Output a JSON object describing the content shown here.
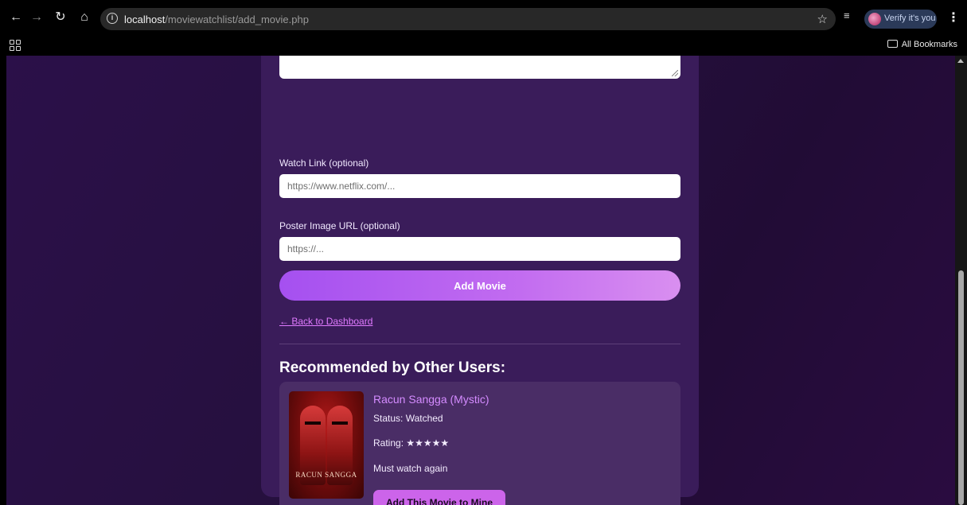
{
  "browser": {
    "url_host": "localhost",
    "url_path": "/moviewatchlist/add_movie.php",
    "profile_label": "Verify it's you",
    "all_bookmarks_label": "All Bookmarks",
    "icons": {
      "back": "back-arrow-icon",
      "forward": "forward-arrow-icon",
      "reload": "reload-icon",
      "home": "home-icon",
      "site_info": "info-icon",
      "bookmark_star": "star-icon",
      "tab_search": "tab-search-icon",
      "menu": "kebab-menu-icon",
      "apps": "apps-grid-icon",
      "folder": "folder-icon"
    }
  },
  "form": {
    "watch_link_label": "Watch Link (optional)",
    "watch_link_placeholder": "https://www.netflix.com/...",
    "watch_link_value": "",
    "poster_label": "Poster Image URL (optional)",
    "poster_placeholder": "https://...",
    "poster_value": "",
    "submit_label": "Add Movie",
    "back_link": "← Back to Dashboard"
  },
  "recommendations": {
    "heading": "Recommended by Other Users:",
    "items": [
      {
        "title": "Racun Sangga (Mystic)",
        "status": "Status: Watched",
        "rating": "Rating: ★★★★★",
        "note": "Must watch again",
        "action_label": "Add This Movie to Mine",
        "poster_text": "RACUN SANGGA"
      }
    ]
  },
  "colors": {
    "page_bg": "#26103f",
    "card_bg": "#3a1c5a",
    "rec_card_bg": "#4a2d66",
    "accent": "#c26cf0",
    "link": "#e07aff"
  }
}
